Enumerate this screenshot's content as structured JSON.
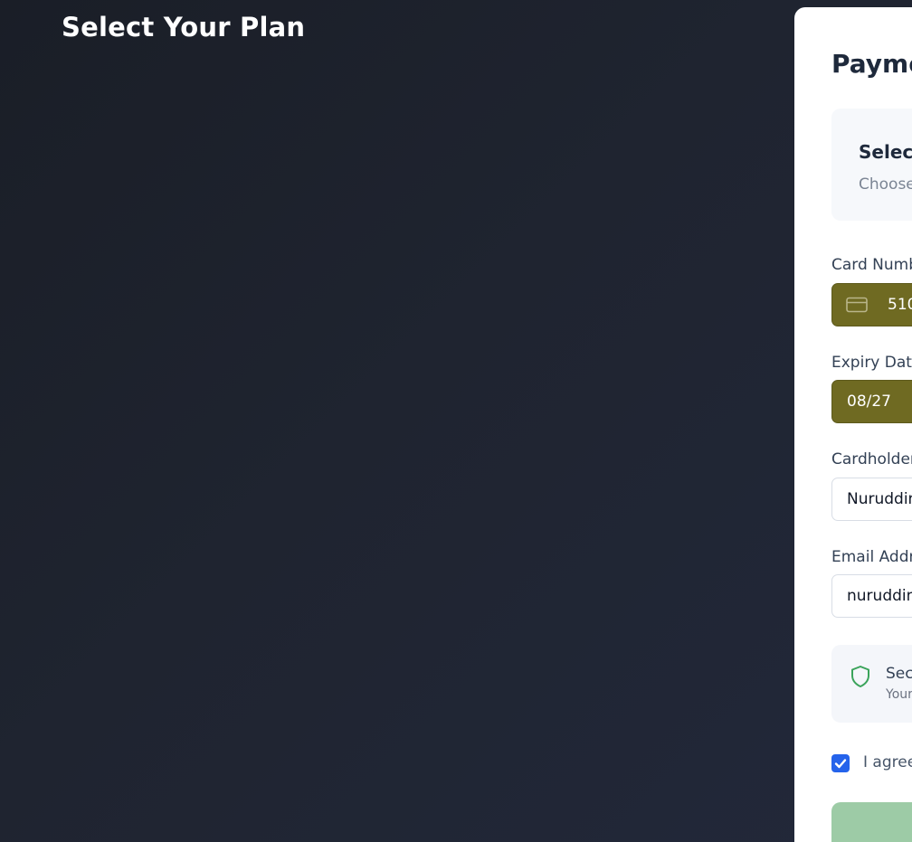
{
  "page": {
    "title": "Select Your Plan"
  },
  "payment": {
    "title": "Payme",
    "plan": {
      "title": "Select",
      "subtitle": "Choose"
    },
    "fields": {
      "card_number": {
        "label": "Card Numb",
        "value": "510",
        "icon": "credit-card-icon"
      },
      "expiry": {
        "label": "Expiry Date",
        "value": "08/27"
      },
      "cardholder": {
        "label": "Cardholder",
        "value": "Nuruddin"
      },
      "email": {
        "label": "Email Addre",
        "value": "nuruddins"
      }
    },
    "secure": {
      "icon": "shield-icon",
      "title": "Secu",
      "subtitle": "Your"
    },
    "agree": {
      "checked": true,
      "text": "I agree"
    },
    "submit": {
      "label": ""
    }
  },
  "colors": {
    "background": "#1f2430",
    "filled_input": "#6f6a22",
    "checkbox": "#2563eb",
    "submit_button": "#9dcba6",
    "shield": "#3aa35a"
  }
}
